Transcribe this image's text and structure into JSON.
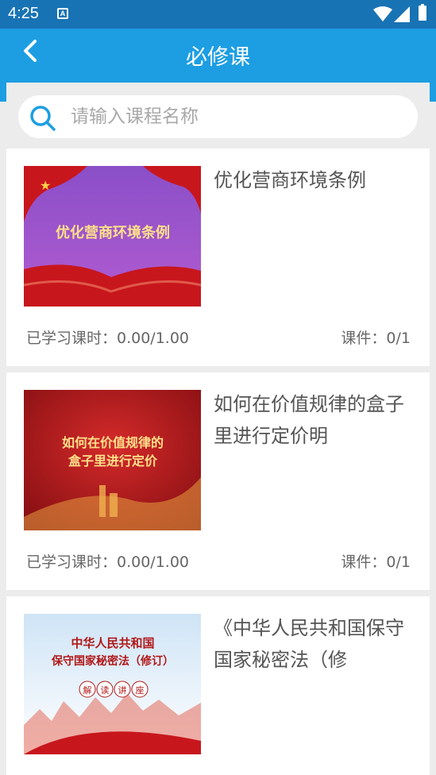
{
  "status_bar": {
    "time": "4:25",
    "notification_icon": "A"
  },
  "header": {
    "title": "必修课",
    "back_icon": "chevron-left"
  },
  "search": {
    "placeholder": "请输入课程名称"
  },
  "courses": [
    {
      "title": "优化营商环境条例",
      "thumb_text": [
        "优化营商环境条例"
      ],
      "progress": "已学习课时：0.00/1.00",
      "courseware": "课件：0/1"
    },
    {
      "title": "如何在价值规律的盒子里进行定价明",
      "thumb_text": [
        "如何在价值规律的",
        "盒子里进行定价"
      ],
      "progress": "已学习课时：0.00/1.00",
      "courseware": "课件：0/1"
    },
    {
      "title": "《中华人民共和国保守国家秘密法（修",
      "thumb_text": [
        "中华人民共和国",
        "保守国家秘密法（修订）",
        "解",
        "读",
        "讲",
        "座"
      ]
    }
  ],
  "colors": {
    "status_bar": "#1873b4",
    "app_bar": "#1d9ee2",
    "accent": "#1d9ee2"
  }
}
